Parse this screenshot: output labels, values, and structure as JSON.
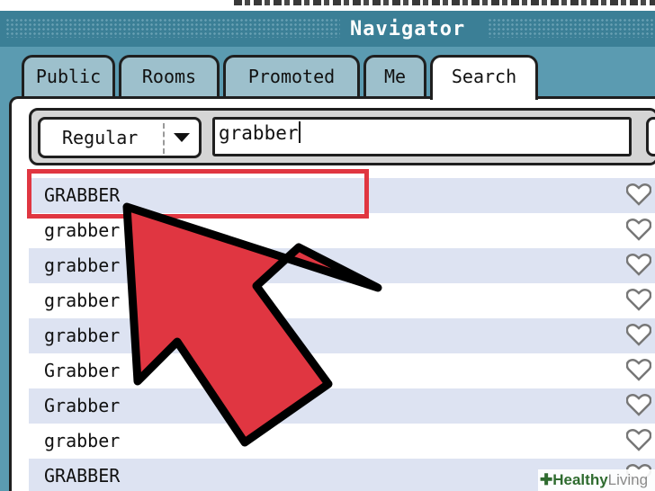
{
  "window": {
    "title": "Navigator"
  },
  "tabs": [
    {
      "label": "Public",
      "active": false
    },
    {
      "label": "Rooms",
      "active": false
    },
    {
      "label": "Promoted",
      "active": false
    },
    {
      "label": "Me",
      "active": false
    },
    {
      "label": "Search",
      "active": true
    }
  ],
  "search": {
    "mode": "Regular",
    "query": "grabber"
  },
  "results": [
    {
      "name": "GRABBER"
    },
    {
      "name": "grabber"
    },
    {
      "name": "grabber"
    },
    {
      "name": "grabber"
    },
    {
      "name": "grabber"
    },
    {
      "name": "Grabber"
    },
    {
      "name": "Grabber"
    },
    {
      "name": "grabber"
    },
    {
      "name": "GRABBER"
    }
  ],
  "icons": {
    "favorite": "heart-outline-icon",
    "dropdown": "triangle-down-icon",
    "pointer": "arrow-pointer-icon"
  },
  "colors": {
    "titlebar": "#3b7f96",
    "background": "#5b9bb1",
    "tab": "#9dc0cc",
    "row_alt": "#dde3f2",
    "highlight": "#e03641",
    "arrow": "#e03641"
  },
  "watermark": {
    "brand_first": "Healthy",
    "brand_second": "Living"
  }
}
